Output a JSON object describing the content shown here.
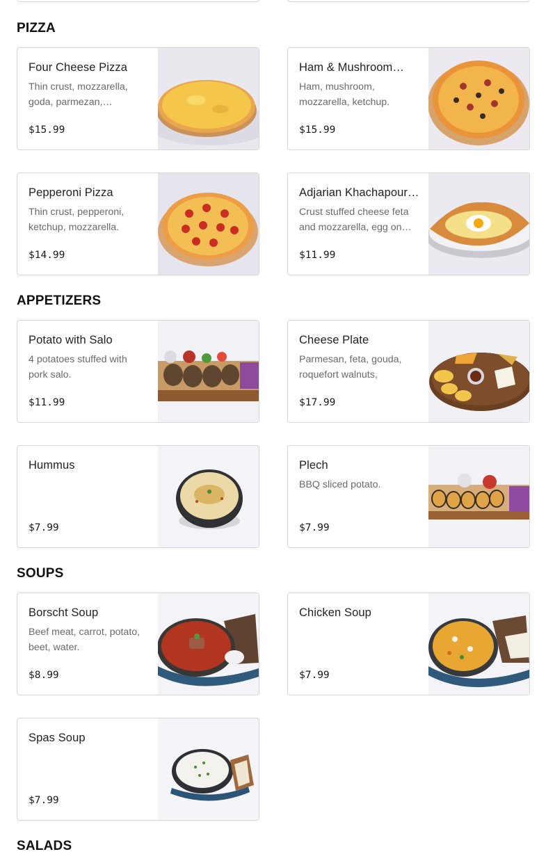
{
  "sections": [
    {
      "title": "PIZZA",
      "items": [
        {
          "name": "Four Cheese Pizza",
          "description": "Thin crust, mozzarella, goda, parmezan,…",
          "price": "$15.99",
          "image": "four-cheese-pizza"
        },
        {
          "name": "Ham & Mushroom…",
          "description": "Ham, mushroom, mozzarella, ketchup.",
          "price": "$15.99",
          "image": "ham-mushroom-pizza"
        },
        {
          "name": "Pepperoni Pizza",
          "description": "Thin crust, pepperoni, ketchup, mozzarella.",
          "price": "$14.99",
          "image": "pepperoni-pizza"
        },
        {
          "name": "Adjarian Khachapour…",
          "description": "Crust stuffed cheese feta and mozzarella, egg on…",
          "price": "$11.99",
          "image": "khachapuri"
        }
      ]
    },
    {
      "title": "APPETIZERS",
      "items": [
        {
          "name": "Potato with Salo",
          "description": "4 potatoes stuffed with pork salo.",
          "price": "$11.99",
          "image": "potato-salo"
        },
        {
          "name": "Cheese Plate",
          "description": "Parmesan, feta, gouda, roquefort walnuts, honey…",
          "price": "$17.99",
          "image": "cheese-plate"
        },
        {
          "name": "Hummus",
          "description": "",
          "price": "$7.99",
          "image": "hummus"
        },
        {
          "name": "Plech",
          "description": "BBQ sliced potato.",
          "price": "$7.99",
          "image": "plech"
        }
      ]
    },
    {
      "title": "SOUPS",
      "items": [
        {
          "name": "Borscht Soup",
          "description": "Beef meat, carrot, potato, beet, water.",
          "price": "$8.99",
          "image": "borscht"
        },
        {
          "name": "Chicken Soup",
          "description": "",
          "price": "$7.99",
          "image": "chicken-soup"
        },
        {
          "name": "Spas Soup",
          "description": "",
          "price": "$7.99",
          "image": "spas-soup"
        }
      ]
    },
    {
      "title": "SALADS",
      "items": []
    }
  ]
}
